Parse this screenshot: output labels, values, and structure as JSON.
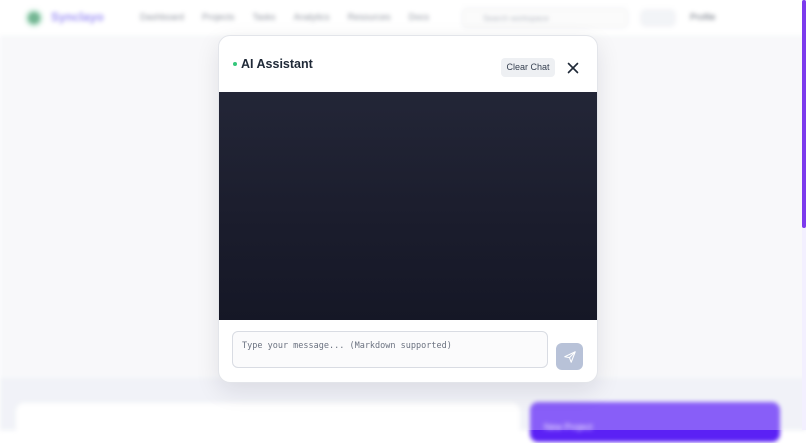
{
  "background": {
    "brand": "Synclayo",
    "nav_links": [
      "Dashboard",
      "Projects",
      "Tasks",
      "Analytics",
      "Resources",
      "Docs"
    ],
    "search_placeholder": "Search workspace",
    "user_label": "Profile",
    "cta_label": "New Project",
    "accent_color": "#5b21f5"
  },
  "modal": {
    "title": "AI Assistant",
    "status_color": "#34c77b",
    "clear_label": "Clear Chat",
    "close_icon": "close-icon",
    "composer": {
      "placeholder": "Type your message... (Markdown supported)",
      "value": ""
    },
    "send_icon": "send-icon"
  }
}
